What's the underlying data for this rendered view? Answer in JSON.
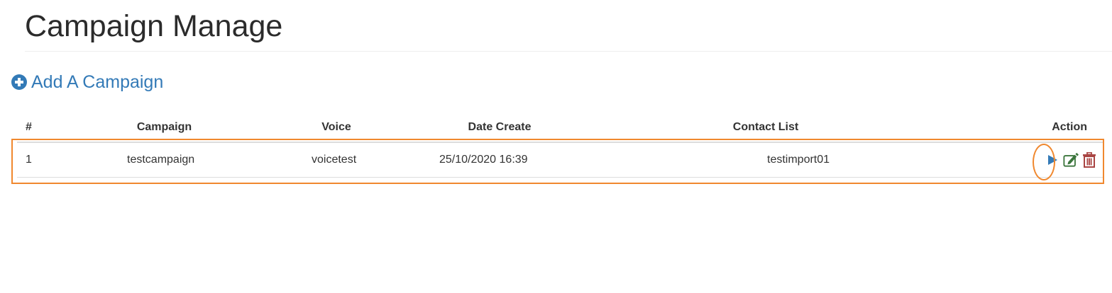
{
  "page": {
    "title": "Campaign Manage"
  },
  "add_campaign": {
    "label": "Add A Campaign",
    "icon": "plus-circle-icon",
    "color": "#337ab7"
  },
  "table": {
    "columns": [
      "#",
      "Campaign",
      "Voice",
      "Date Create",
      "Contact List",
      "Action"
    ],
    "rows": [
      {
        "num": "1",
        "campaign": "testcampaign",
        "voice": "voicetest",
        "date_create": "25/10/2020 16:39",
        "contact_list": "testimport01",
        "actions": [
          "play-icon",
          "edit-icon",
          "delete-icon"
        ]
      }
    ]
  },
  "colors": {
    "highlight": "#f0882e",
    "play": "#337ab7",
    "edit": "#3c763d",
    "delete": "#a94442"
  }
}
